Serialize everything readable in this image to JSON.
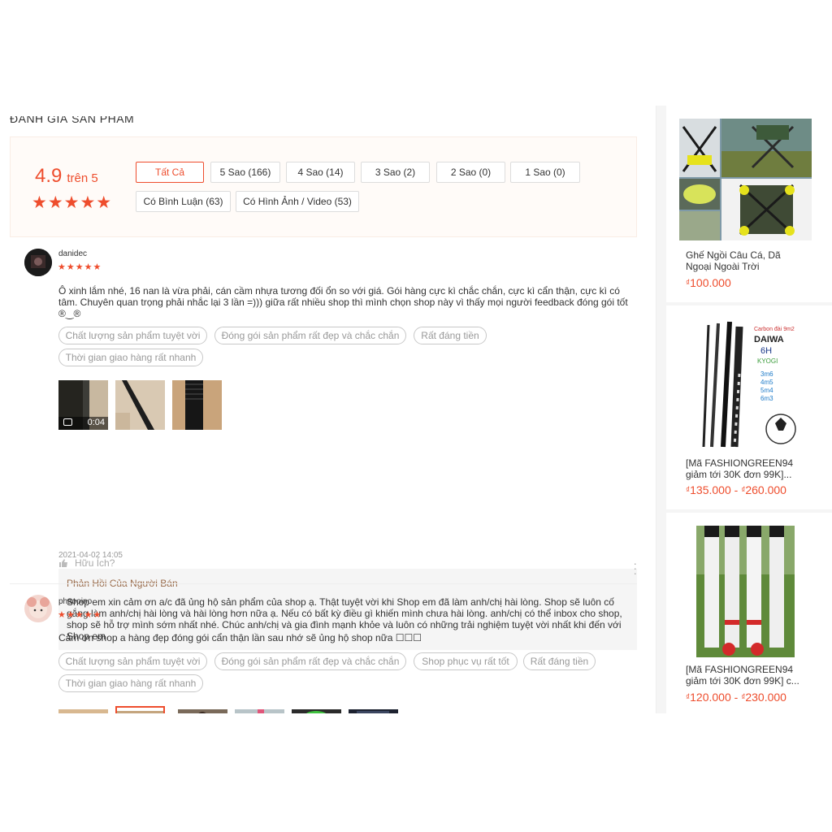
{
  "section_title": "ĐÁNH GIÁ SẢN PHẨM",
  "rating": {
    "score": "4.9",
    "out_of": "trên 5",
    "stars": "★★★★★"
  },
  "filters": [
    "Tất Cả",
    "5 Sao (166)",
    "4 Sao (14)",
    "3 Sao (2)",
    "2 Sao (0)",
    "1 Sao (0)",
    "Có Bình Luận (63)",
    "Có Hình Ảnh / Video (53)"
  ],
  "reviews": [
    {
      "username": "danidec",
      "stars": "★★★★★",
      "text": "Ô xinh lắm nhé, 16 nan là vừa phải, cán cầm nhựa tương đối ổn so với giá. Gói hàng cực kì chắc chắn, cực kì cẩn thận, cực kì có tâm. Chuyên quan trọng phải nhắc lại 3 lần =))) giữa rất nhiều shop thì mình chọn shop này vì thấy mọi người feedback đóng gói tốt ®‿®",
      "tags": [
        "Chất lượng sản phẩm tuyệt vời",
        "Đóng gói sản phẩm rất đẹp và chắc chắn",
        "Rất đáng tiền",
        "Thời gian giao hàng rất nhanh"
      ],
      "video_duration": "0:04",
      "date": "2021-04-02 14:05",
      "reply_title": "Phản Hồi Của Người Bán",
      "reply_text": "Shop em xin cảm ơn a/c đã ủng hộ sản phẩm của shop ạ. Thật tuyệt vời khi Shop em đã làm anh/chị hài lòng. Shop sẽ luôn cố gắng làm anh/chị hài lòng và hài lòng hơn nữa ạ. Nếu có bất kỳ điều gì khiến mình chưa hài lòng. anh/chị có thể inbox cho shop, shop sẽ hỗ trợ mình sớm nhất nhé. Chúc anh/chị và gia đình mạnh khỏe và luôn có những trải nghiệm tuyệt vời nhất khi đến với Shop em",
      "helpful": "Hữu Ích?"
    },
    {
      "username": "phaooino",
      "stars": "★★★★★",
      "text": "Cảm ơn shop a hàng đẹp đóng gói cẩn thận lần sau nhớ sẽ ủng hộ shop nữa ☐☐☐",
      "tags": [
        "Chất lượng sản phẩm tuyệt vời",
        "Đóng gói sản phẩm rất đẹp và chắc chắn",
        "Shop phục vụ rất tốt",
        "Rất đáng tiền",
        "Thời gian giao hàng rất nhanh"
      ]
    }
  ],
  "sidebar_products": [
    {
      "name": "Ghế Ngồi Câu Cá, Dã Ngoại Ngoài Trời",
      "currency": "₫",
      "price": "100.000"
    },
    {
      "name": "[Mã FASHIONGREEN94 giảm tới 30K đơn 99K]...",
      "currency": "₫",
      "price": "135.000",
      "price_sep": " - ",
      "currency2": "₫",
      "price2": "260.000",
      "img_text": {
        "l1": "Carbon đài 9m2",
        "brand": "DAIWA",
        "model": "6H",
        "kyogi": "KYOGI",
        "sizes": [
          "3m6",
          "4m5",
          "5m4",
          "6m3"
        ]
      }
    },
    {
      "name": "[Mã FASHIONGREEN94 giảm tới 30K đơn 99K] c...",
      "currency": "₫",
      "price": "120.000",
      "price_sep": " - ",
      "currency2": "₫",
      "price2": "230.000"
    }
  ]
}
